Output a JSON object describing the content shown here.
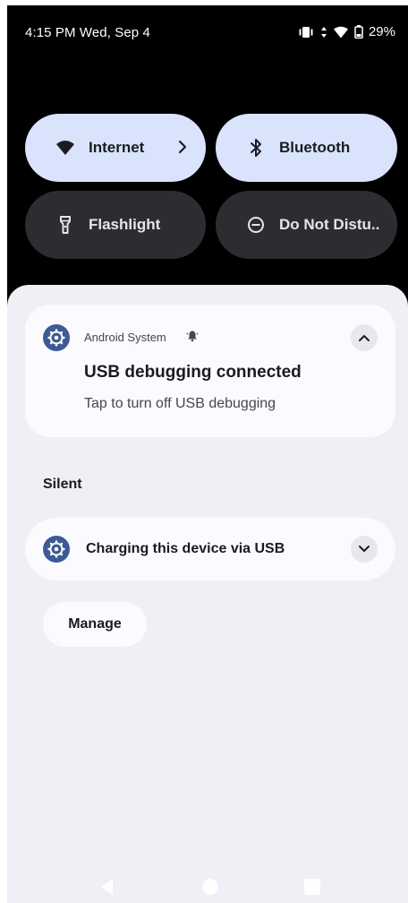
{
  "status_bar": {
    "time": "4:15 PM Wed, Sep 4",
    "battery": "29%",
    "icons": [
      "vibrate-icon",
      "data-arrows-icon",
      "wifi-icon",
      "battery-icon"
    ]
  },
  "quick_settings": {
    "tiles": [
      {
        "label": "Internet",
        "icon": "wifi-icon",
        "state": "on",
        "has_chevron": true
      },
      {
        "label": "Bluetooth",
        "icon": "bluetooth-icon",
        "state": "on"
      },
      {
        "label": "Flashlight",
        "icon": "flashlight-icon",
        "state": "off"
      },
      {
        "label": "Do Not Distu..",
        "icon": "do-not-disturb-icon",
        "state": "off"
      }
    ]
  },
  "notifications": {
    "alerting": {
      "app_name": "Android System",
      "app_icon": "settings-gear-icon",
      "alert_icon": "bell-icon",
      "title": "USB debugging connected",
      "text": "Tap to turn off USB debugging",
      "expand_icon": "chevron-up-icon"
    },
    "silent_section_label": "Silent",
    "silent": [
      {
        "title": "Charging this device via USB",
        "app_icon": "settings-gear-icon",
        "expand_icon": "chevron-down-icon"
      }
    ],
    "manage_label": "Manage"
  },
  "nav_bar": {
    "buttons": [
      "back",
      "home",
      "recents"
    ]
  },
  "colors": {
    "shade_bg": "#f0eff6",
    "card_bg": "#fbfafe",
    "tile_active": "#d9e3fb",
    "tile_inactive": "#2c2d31",
    "app_icon_bg": "#3d5a94"
  }
}
